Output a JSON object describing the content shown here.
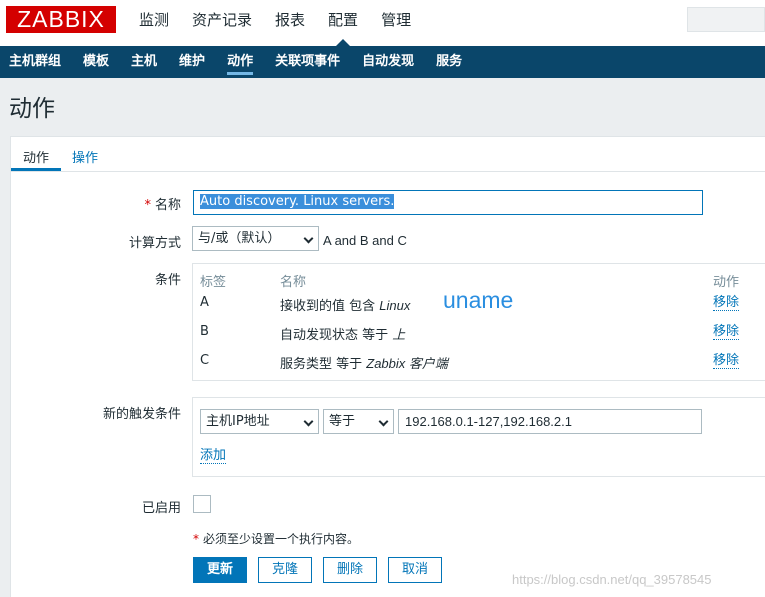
{
  "app": {
    "logo": "ZABBIX"
  },
  "top_menu": {
    "items": [
      "监测",
      "资产记录",
      "报表",
      "配置",
      "管理"
    ],
    "active_index": 3
  },
  "sub_menu": {
    "items": [
      "主机群组",
      "模板",
      "主机",
      "维护",
      "动作",
      "关联项事件",
      "自动发现",
      "服务"
    ],
    "active_index": 4
  },
  "page": {
    "title": "动作"
  },
  "tabs": [
    "动作",
    "操作"
  ],
  "form": {
    "name_label": "名称",
    "required_mark": "*",
    "name_value": "Auto discovery. Linux servers.",
    "calc_label": "计算方式",
    "calc_selected": "与/或（默认）",
    "calc_expression": "A and B and C",
    "conditions_label": "条件",
    "conditions": {
      "headers": {
        "label": "标签",
        "name": "名称",
        "action": "动作"
      },
      "rows": [
        {
          "label": "A",
          "text": "接收到的值 包含 ",
          "value": "Linux",
          "action": "移除"
        },
        {
          "label": "B",
          "text": "自动发现状态 等于 ",
          "value": "上",
          "action": "移除"
        },
        {
          "label": "C",
          "text": "服务类型 等于 ",
          "value": "Zabbix 客户端",
          "action": "移除"
        }
      ],
      "annotation": "uname"
    },
    "new_condition_label": "新的触发条件",
    "new_condition": {
      "type_selected": "主机IP地址",
      "operator_selected": "等于",
      "value": "192.168.0.1-127,192.168.2.1",
      "add_label": "添加"
    },
    "enabled_label": "已启用",
    "enabled": false,
    "note": "必须至少设置一个执行内容。",
    "buttons": {
      "update": "更新",
      "clone": "克隆",
      "delete": "删除",
      "cancel": "取消"
    }
  },
  "watermark": "https://blog.csdn.net/qq_39578545",
  "colors": {
    "brand": "#d40000",
    "nav": "#0a466a",
    "link": "#0275b8"
  }
}
